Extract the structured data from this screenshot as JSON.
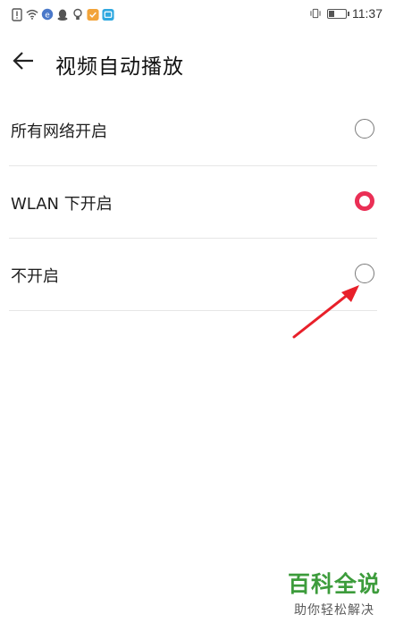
{
  "status_bar": {
    "time": "11:37",
    "battery_level": 0.35,
    "icons_left": [
      "alert-icon",
      "wifi-icon",
      "app-icon",
      "qq-icon",
      "bulb-icon",
      "shield-app-icon",
      "tv-app-icon"
    ],
    "icons_right": [
      "vibrate-icon",
      "battery-icon"
    ]
  },
  "header": {
    "title": "视频自动播放",
    "back_icon": "arrow-left-icon"
  },
  "options": [
    {
      "label": "所有网络开启",
      "selected": false
    },
    {
      "label": "WLAN 下开启",
      "selected": true
    },
    {
      "label": "不开启",
      "selected": false
    }
  ],
  "annotation": {
    "arrow_color": "#e8202a"
  },
  "watermark": {
    "brand": "百科全说",
    "tagline": "助你轻松解决"
  },
  "colors": {
    "accent": "#ea2f55",
    "watermark_green": "#3d9c3c"
  }
}
